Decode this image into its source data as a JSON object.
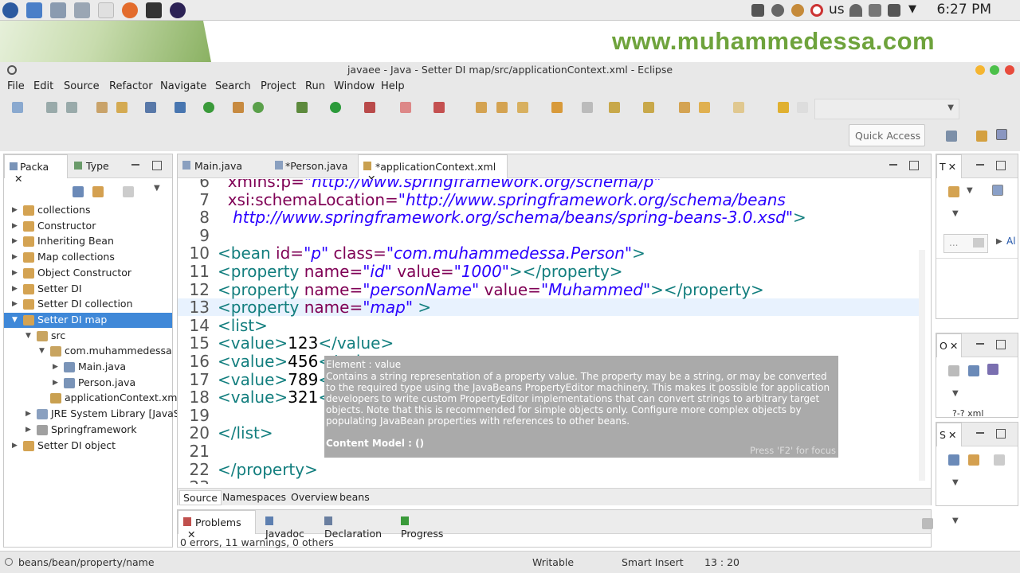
{
  "system_bar": {
    "lang": "us",
    "clock": "6:27 PM"
  },
  "banner": {
    "text": "www.muhammedessa.com"
  },
  "window": {
    "title": "javaee - Java - Setter DI map/src/applicationContext.xml - Eclipse"
  },
  "menu": [
    "File",
    "Edit",
    "Source",
    "Refactor",
    "Navigate",
    "Search",
    "Project",
    "Run",
    "Window",
    "Help"
  ],
  "quick_access": {
    "label": "Quick Access"
  },
  "package_explorer": {
    "tabs": [
      "Packa",
      "Type"
    ],
    "items": [
      {
        "label": "collections",
        "depth": 0,
        "expanded": false
      },
      {
        "label": "Constructor",
        "depth": 0,
        "expanded": false
      },
      {
        "label": "Inheriting Bean",
        "depth": 0,
        "expanded": false
      },
      {
        "label": "Map collections",
        "depth": 0,
        "expanded": false
      },
      {
        "label": "Object Constructor",
        "depth": 0,
        "expanded": false
      },
      {
        "label": "Setter DI",
        "depth": 0,
        "expanded": false
      },
      {
        "label": "Setter DI collection",
        "depth": 0,
        "expanded": false
      },
      {
        "label": "Setter DI map",
        "depth": 0,
        "expanded": true,
        "selected": true
      },
      {
        "label": "src",
        "depth": 1,
        "expanded": true
      },
      {
        "label": "com.muhammedessa",
        "depth": 2,
        "expanded": true
      },
      {
        "label": "Main.java",
        "depth": 3,
        "expanded": false
      },
      {
        "label": "Person.java",
        "depth": 3,
        "expanded": false
      },
      {
        "label": "applicationContext.xml",
        "depth": 2,
        "leaf": true
      },
      {
        "label": "JRE System Library [JavaSE",
        "depth": 1,
        "expanded": false
      },
      {
        "label": "Springframework",
        "depth": 1,
        "expanded": false
      },
      {
        "label": "Setter DI object",
        "depth": 0,
        "expanded": false
      }
    ]
  },
  "editor": {
    "tabs": [
      "Main.java",
      "*Person.java",
      "*applicationContext.xml"
    ],
    "active_tab": "*applicationContext.xml",
    "lines": [
      {
        "n": "6",
        "parts": [
          [
            "attr",
            "  xmlns:p="
          ],
          [
            "val",
            "\"http://www.springframework.org/schema/p\""
          ]
        ]
      },
      {
        "n": "7",
        "parts": [
          [
            "attr",
            "  xsi:schemaLocation="
          ],
          [
            "val",
            "\"http://www.springframework.org/schema/beans"
          ]
        ]
      },
      {
        "n": "8",
        "parts": [
          [
            "val",
            "   http://www.springframework.org/schema/beans/spring-beans-3.0.xsd\""
          ],
          [
            "tag",
            ">"
          ]
        ]
      },
      {
        "n": "9",
        "parts": []
      },
      {
        "n": "10",
        "parts": [
          [
            "tag",
            "<bean "
          ],
          [
            "attr",
            "id="
          ],
          [
            "val",
            "\"p\""
          ],
          [
            "attr",
            " class="
          ],
          [
            "val",
            "\"com.muhammedessa.Person\""
          ],
          [
            "tag",
            ">"
          ]
        ]
      },
      {
        "n": "11",
        "parts": [
          [
            "tag",
            "<property "
          ],
          [
            "attr",
            "name="
          ],
          [
            "val",
            "\"id\""
          ],
          [
            "attr",
            " value="
          ],
          [
            "val",
            "\"1000\""
          ],
          [
            "tag",
            "></property>"
          ]
        ]
      },
      {
        "n": "12",
        "parts": [
          [
            "tag",
            "<property "
          ],
          [
            "attr",
            "name="
          ],
          [
            "val",
            "\"personName\""
          ],
          [
            "attr",
            " value="
          ],
          [
            "val",
            "\"Muhammed\""
          ],
          [
            "tag",
            "></property>"
          ]
        ]
      },
      {
        "n": "13",
        "parts": [
          [
            "tag",
            "<property "
          ],
          [
            "attr",
            "name="
          ],
          [
            "val",
            "\"map\""
          ],
          [
            "tag",
            " >"
          ]
        ]
      },
      {
        "n": "14",
        "parts": [
          [
            "tag",
            "<list>"
          ]
        ]
      },
      {
        "n": "15",
        "parts": [
          [
            "tag",
            "<value>"
          ],
          [
            "txt",
            "123"
          ],
          [
            "tag",
            "</value>"
          ]
        ]
      },
      {
        "n": "16",
        "parts": [
          [
            "tag",
            "<value>"
          ],
          [
            "txt",
            "456"
          ],
          [
            "tag",
            "</value>"
          ]
        ]
      },
      {
        "n": "17",
        "parts": [
          [
            "tag",
            "<value>"
          ],
          [
            "txt",
            "789"
          ],
          [
            "tag",
            "</value>"
          ]
        ]
      },
      {
        "n": "18",
        "parts": [
          [
            "tag",
            "<value>"
          ],
          [
            "txt",
            "321"
          ],
          [
            "tag",
            "</value>"
          ]
        ]
      },
      {
        "n": "19",
        "parts": []
      },
      {
        "n": "20",
        "parts": [
          [
            "tag",
            "</list>"
          ]
        ]
      },
      {
        "n": "21",
        "parts": []
      },
      {
        "n": "22",
        "parts": [
          [
            "tag",
            "</property>"
          ]
        ]
      },
      {
        "n": "23",
        "parts": []
      }
    ],
    "bottom_tabs": [
      "Source",
      "Namespaces",
      "Overview",
      "beans"
    ]
  },
  "tooltip": {
    "title": "Element : value",
    "body": "Contains a string representation of a property value. The property may be a string, or may be converted to the required type using the JavaBeans PropertyEditor machinery. This makes it possible for application developers to write custom PropertyEditor implementations that can convert strings to arbitrary target objects. Note that this is recommended for simple objects only. Configure more complex objects by populating JavaBean properties with references to other beans.",
    "content_model": "Content Model : ()",
    "focus_hint": "Press 'F2' for focus"
  },
  "right_panels": {
    "top_tab": "T",
    "search_placeholder": "...",
    "top_link": "Al",
    "mid_tab": "O",
    "mid_item": "?-? xml",
    "bottom_tab": "S"
  },
  "problems": {
    "tabs": [
      "Problems",
      "Javadoc",
      "Declaration",
      "Progress"
    ],
    "status": "0 errors, 11 warnings, 0 others"
  },
  "status_bar": {
    "path": "beans/bean/property/name",
    "writable": "Writable",
    "insert_mode": "Smart Insert",
    "position": "13 : 20"
  },
  "colors": {
    "tag": "#127e7e",
    "attr": "#7f0055",
    "value": "#2a00ff",
    "selection": "#3f88d8",
    "banner_text": "#6ea33c"
  }
}
